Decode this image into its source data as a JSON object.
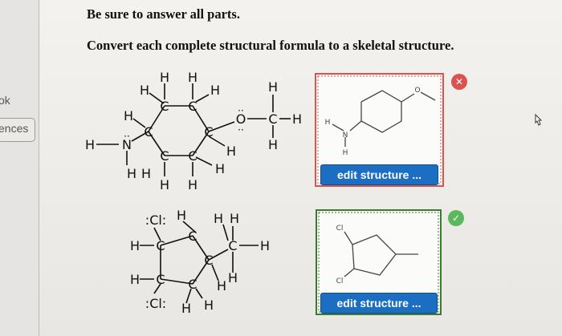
{
  "sidebar": {
    "items": [
      {
        "label": "ok"
      },
      {
        "label": "ences"
      }
    ]
  },
  "instructions": {
    "line1": "Be sure to answer all parts.",
    "line2": "Convert each complete structural formula to a skeletal structure."
  },
  "molecule1": {
    "atoms": {
      "H": "H",
      "C": "C",
      "N": "N",
      "O": "O",
      "lone_pair": ":",
      "lone_pair_top": "··"
    },
    "answer": {
      "atoms": {
        "H": "H",
        "N": "N",
        "O": "O"
      },
      "button_label": "edit structure ...",
      "status": "incorrect",
      "status_color": "#d9534f",
      "status_icon": "x-icon"
    }
  },
  "molecule2": {
    "atoms": {
      "H": "H",
      "C": "C",
      "Cl_top": ":Cl:",
      "Cl_bottom": ":Cl:"
    },
    "answer": {
      "atoms": {
        "Cl": "Cl"
      },
      "button_label": "edit structure ...",
      "status": "correct",
      "status_color": "#5cb85c",
      "status_icon": "check-icon"
    }
  },
  "colors": {
    "button": "#1b6ec2",
    "incorrect_frame": "#d9534f",
    "correct_frame": "#3c7a2f"
  }
}
